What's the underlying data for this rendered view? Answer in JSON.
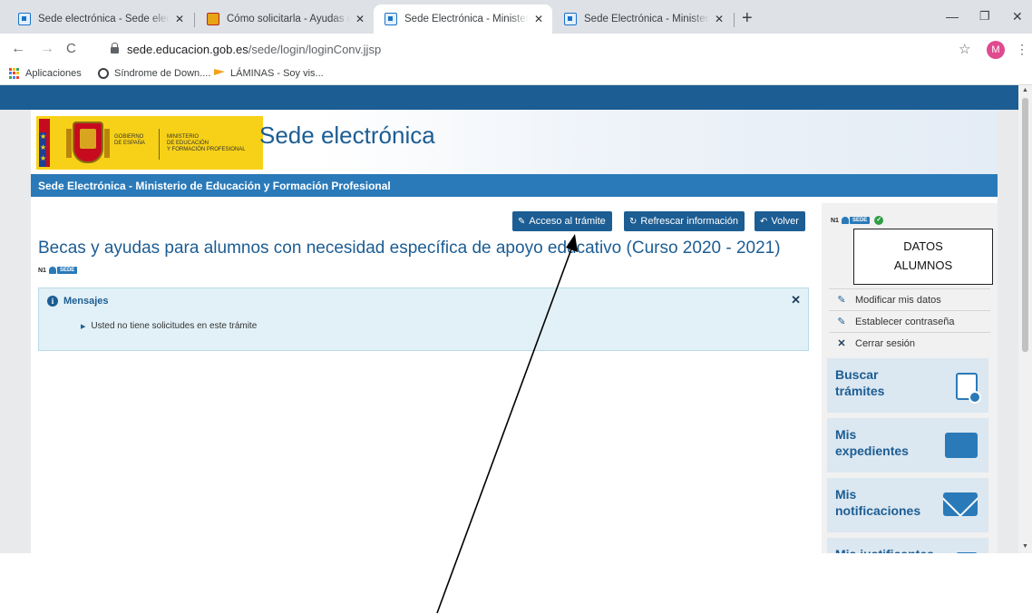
{
  "browser": {
    "tabs": [
      {
        "title": "Sede electrónica - Sede electrónica",
        "active": false
      },
      {
        "title": "Cómo solicitarla - Ayudas de apoyo",
        "active": false
      },
      {
        "title": "Sede Electrónica - Ministerio de Educación",
        "active": true
      },
      {
        "title": "Sede Electrónica - Ministerio de Educación",
        "active": false
      }
    ],
    "url_host": "sede.educacion.gob.es",
    "url_path": "/sede/login/loginConv.jjsp",
    "profile_initial": "M",
    "bookmarks": [
      {
        "label": "Aplicaciones"
      },
      {
        "label": "Síndrome de Down...."
      },
      {
        "label": "LÁMINAS - Soy vis..."
      }
    ]
  },
  "page": {
    "logo": {
      "gobierno_line1": "GOBIERNO",
      "gobierno_line2": "DE ESPAÑA",
      "ministerio_line1": "MINISTERIO",
      "ministerio_line2": "DE EDUCACIÓN",
      "ministerio_line3": "Y FORMACIÓN PROFESIONAL"
    },
    "site_title": "Sede electrónica",
    "subbar_title": "Sede Electrónica - Ministerio de Educación y Formación Profesional",
    "buttons": {
      "acceso": "Acceso al trámite",
      "refrescar": "Refrescar información",
      "volver": "Volver"
    },
    "main_title": "Becas y ayudas para alumnos con necesidad específica de apoyo educativo (Curso 2020 - 2021)",
    "level": {
      "n": "N1",
      "tag": "SEDE"
    },
    "messages": {
      "title": "Mensajes",
      "item": "Usted no tiene solicitudes en este trámite"
    },
    "sidebar": {
      "datos_line1": "DATOS",
      "datos_line2": "ALUMNOS",
      "links": [
        "Modificar mis datos",
        "Establecer contraseña",
        "Cerrar sesión"
      ],
      "tiles": [
        {
          "line1": "Buscar",
          "line2": "trámites"
        },
        {
          "line1": "Mis",
          "line2": "expedientes"
        },
        {
          "line1": "Mis",
          "line2": "notificaciones"
        },
        {
          "line1": "Mis justificantes",
          "line2": ""
        }
      ]
    },
    "colors": {
      "primary": "#1c5d93",
      "secondary": "#2a7ab9",
      "tile": "#dbe7f1",
      "ok": "#2e9e44"
    }
  }
}
